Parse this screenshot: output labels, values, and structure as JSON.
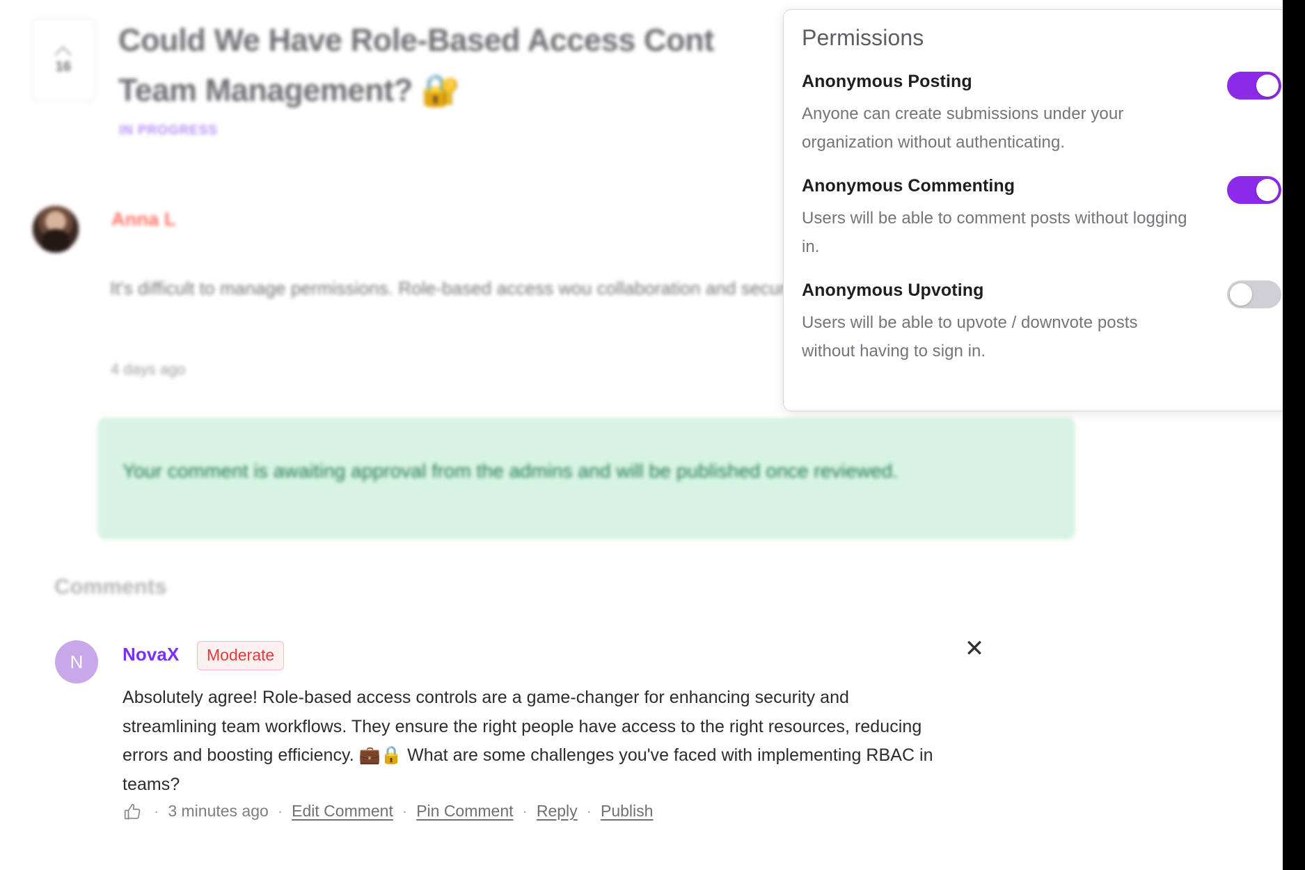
{
  "post": {
    "vote_count": "16",
    "upvote_icon": "chevron-up-icon",
    "title": "Could We Have Role-Based Access Cont\nTeam Management? 🔐",
    "status": "IN PROGRESS",
    "author": "Anna L",
    "body": "It's difficult to manage permissions. Role-based access wou\ncollaboration and security.",
    "time": "4 days ago"
  },
  "notice": {
    "text": "Your comment is awaiting approval from the admins and will be published once reviewed."
  },
  "comments_section": {
    "heading": "Comments",
    "comment": {
      "avatar_initial": "N",
      "author": "NovaX",
      "badge": "Moderate",
      "close_icon": "close-icon",
      "body": "Absolutely agree! Role-based access controls are a game-changer for enhancing security and streamlining team workflows. They ensure the right people have access to the right resources, reducing errors and boosting efficiency. 💼🔒 What are some challenges you've faced with implementing RBAC in teams?",
      "actions": {
        "like_icon": "thumbs-up-icon",
        "separator": "·",
        "time": "3 minutes ago",
        "edit": "Edit Comment",
        "pin": "Pin Comment",
        "reply": "Reply",
        "publish": "Publish"
      }
    }
  },
  "permissions_panel": {
    "title": "Permissions",
    "items": [
      {
        "label": "Anonymous Posting",
        "description": "Anyone can create submissions under your organization without authenticating.",
        "enabled": true
      },
      {
        "label": "Anonymous Commenting",
        "description": "Users will be able to comment posts without logging in.",
        "enabled": true
      },
      {
        "label": "Anonymous Upvoting",
        "description": "Users will be able to upvote / downvote posts without having to sign in.",
        "enabled": false
      }
    ]
  },
  "colors": {
    "accent_purple": "#8b2ae8",
    "status_purple": "#b48cf2",
    "author_red": "#fa6f61",
    "notice_bg": "#d7f3e3",
    "notice_text": "#1f7a50",
    "badge_red": "#e8383c",
    "name_purple": "#7b2ff7",
    "avatar_purple": "#c9a8e9"
  }
}
